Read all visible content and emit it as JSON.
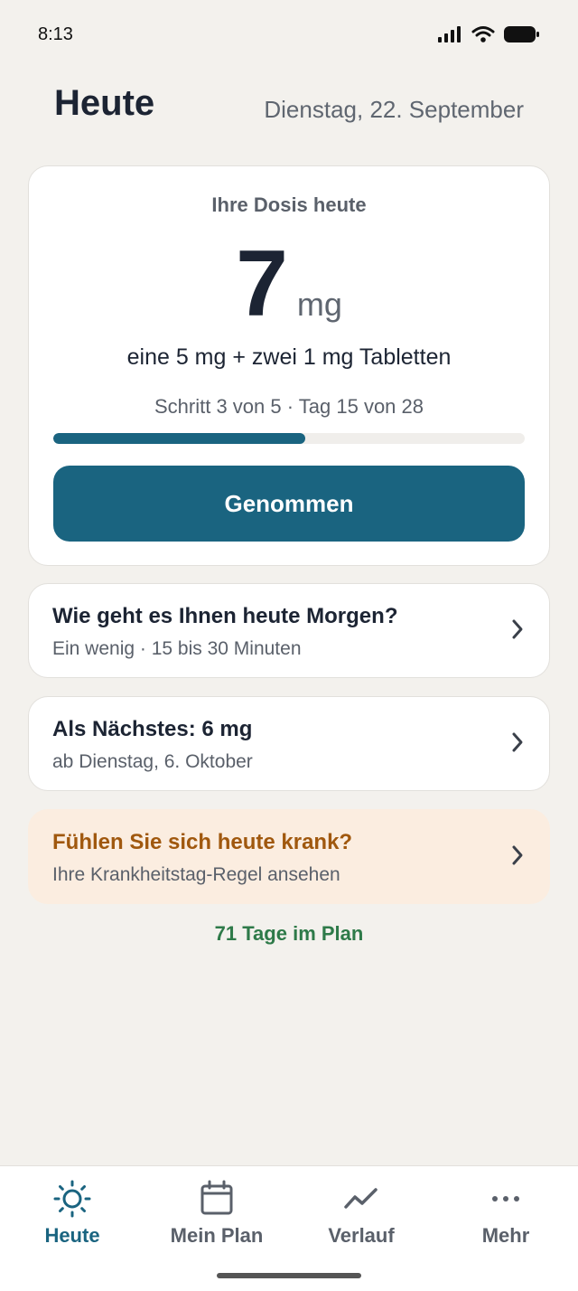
{
  "status": {
    "time": "8:13"
  },
  "header": {
    "title": "Heute",
    "date": "Dienstag, 22. September"
  },
  "dose": {
    "heading": "Ihre Dosis heute",
    "value": "7",
    "unit": "mg",
    "description": "eine 5 mg + zwei 1 mg Tabletten",
    "step_text": "Schritt 3 von 5 · Tag 15 von 28",
    "progress_fraction": 0.535,
    "taken_label": "Genommen"
  },
  "cards": {
    "morning": {
      "title": "Wie geht es Ihnen heute Morgen?",
      "subtitle": "Ein wenig · 15 bis 30 Minuten"
    },
    "next": {
      "title": "Als Nächstes: 6 mg",
      "subtitle": "ab Dienstag, 6. Oktober"
    },
    "sick": {
      "title": "Fühlen Sie sich heute krank?",
      "subtitle": "Ihre Krankheitstag-Regel ansehen"
    }
  },
  "days_in_plan": "71 Tage im Plan",
  "tabs": [
    {
      "label": "Heute",
      "icon": "sun-icon",
      "active": true
    },
    {
      "label": "Mein Plan",
      "icon": "calendar-icon",
      "active": false
    },
    {
      "label": "Verlauf",
      "icon": "trend-icon",
      "active": false
    },
    {
      "label": "Mehr",
      "icon": "more-icon",
      "active": false
    }
  ],
  "colors": {
    "accent": "#1a6480",
    "background": "#f3f1ed",
    "warning_text": "#a0580e",
    "warning_bg": "#fbede0",
    "success_text": "#2e7a49"
  }
}
